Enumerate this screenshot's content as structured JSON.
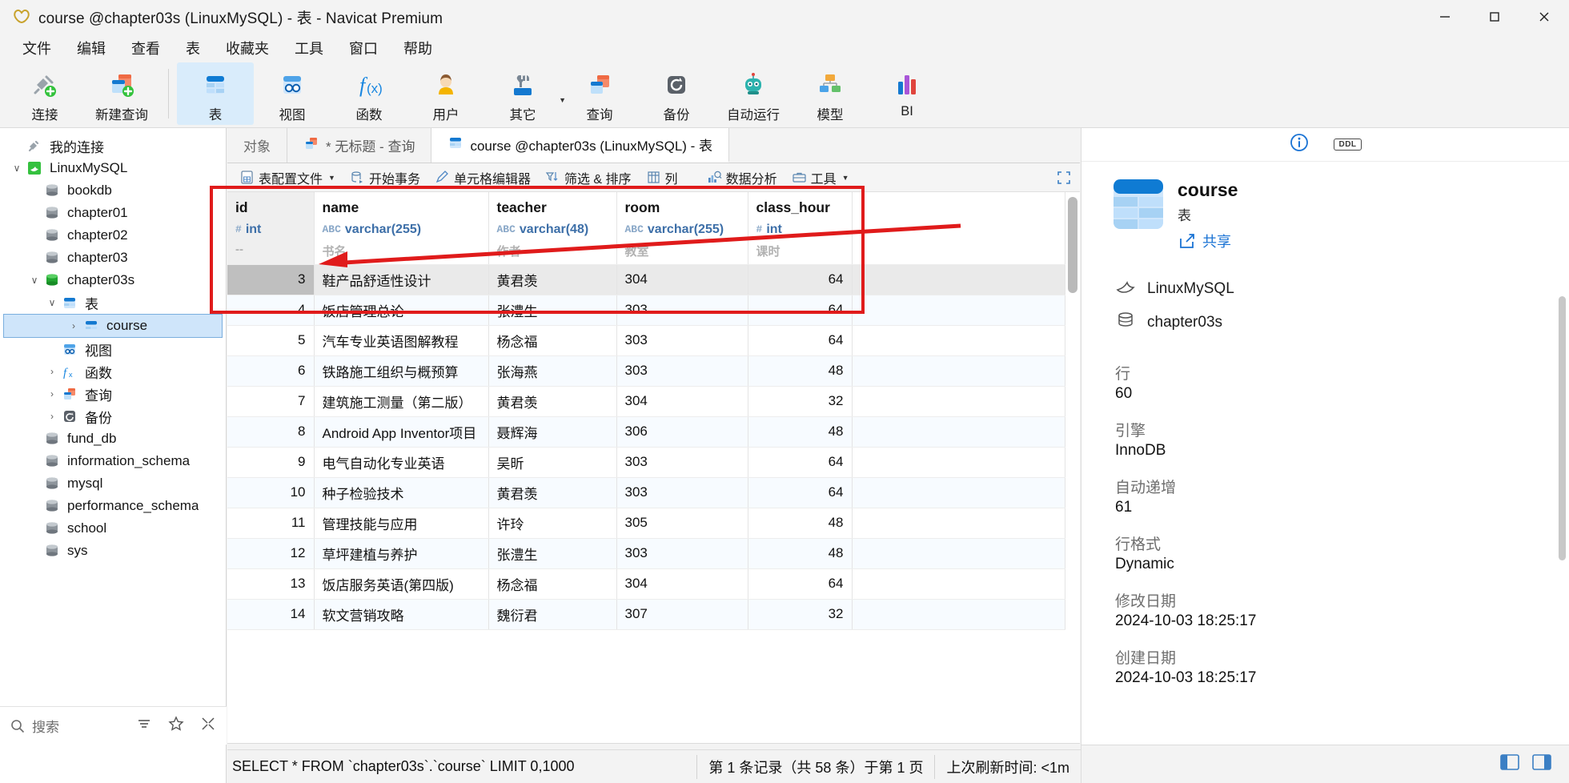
{
  "window": {
    "title": "course @chapter03s (LinuxMySQL) - 表 - Navicat Premium",
    "app_icon": "navicat-logo-icon",
    "minimize_label": "–",
    "maximize_label": "☐",
    "close_label": "✕"
  },
  "menubar": {
    "items": [
      {
        "label": "文件",
        "name": "menu-file"
      },
      {
        "label": "编辑",
        "name": "menu-edit"
      },
      {
        "label": "查看",
        "name": "menu-view"
      },
      {
        "label": "表",
        "name": "menu-table"
      },
      {
        "label": "收藏夹",
        "name": "menu-favorites"
      },
      {
        "label": "工具",
        "name": "menu-tools"
      },
      {
        "label": "窗口",
        "name": "menu-window"
      },
      {
        "label": "帮助",
        "name": "menu-help"
      }
    ]
  },
  "toolbar": {
    "buttons": [
      {
        "label": "连接",
        "icon": "connection-plug-icon",
        "active": false
      },
      {
        "label": "新建查询",
        "icon": "new-query-icon",
        "active": false
      },
      {
        "label": "表",
        "icon": "table-icon",
        "active": true
      },
      {
        "label": "视图",
        "icon": "view-icon",
        "active": false
      },
      {
        "label": "函数",
        "icon": "function-fx-icon",
        "active": false
      },
      {
        "label": "用户",
        "icon": "user-icon",
        "active": false
      },
      {
        "label": "其它",
        "icon": "other-tools-icon",
        "active": false,
        "has_caret": true
      },
      {
        "label": "查询",
        "icon": "query-icon",
        "active": false
      },
      {
        "label": "备份",
        "icon": "backup-icon",
        "active": false
      },
      {
        "label": "自动运行",
        "icon": "automation-robot-icon",
        "active": false
      },
      {
        "label": "模型",
        "icon": "model-icon",
        "active": false
      },
      {
        "label": "BI",
        "icon": "bi-chart-icon",
        "active": false
      }
    ]
  },
  "sidebar": {
    "tree": [
      {
        "label": "我的连接",
        "icon": "plug-icon",
        "indent": 0,
        "arrow": "",
        "selected": false
      },
      {
        "label": "LinuxMySQL",
        "icon": "mysql-dolphin-icon",
        "indent": 1,
        "arrow": "∨",
        "selected": false
      },
      {
        "label": "bookdb",
        "icon": "database-icon",
        "indent": 2,
        "arrow": "",
        "selected": false
      },
      {
        "label": "chapter01",
        "icon": "database-icon",
        "indent": 2,
        "arrow": "",
        "selected": false
      },
      {
        "label": "chapter02",
        "icon": "database-icon",
        "indent": 2,
        "arrow": "",
        "selected": false
      },
      {
        "label": "chapter03",
        "icon": "database-icon",
        "indent": 2,
        "arrow": "",
        "selected": false
      },
      {
        "label": "chapter03s",
        "icon": "database-open-icon",
        "indent": 2,
        "arrow": "∨",
        "selected": false
      },
      {
        "label": "表",
        "icon": "table-folder-icon",
        "indent": 3,
        "arrow": "∨",
        "selected": false
      },
      {
        "label": "course",
        "icon": "table-icon",
        "indent": 4,
        "arrow": "›",
        "selected": true
      },
      {
        "label": "视图",
        "icon": "view-folder-icon",
        "indent": 3,
        "arrow": "",
        "selected": false
      },
      {
        "label": "函数",
        "icon": "function-folder-icon",
        "indent": 3,
        "arrow": "›",
        "selected": false
      },
      {
        "label": "查询",
        "icon": "query-folder-icon",
        "indent": 3,
        "arrow": "›",
        "selected": false
      },
      {
        "label": "备份",
        "icon": "backup-folder-icon",
        "indent": 3,
        "arrow": "›",
        "selected": false
      },
      {
        "label": "fund_db",
        "icon": "database-icon",
        "indent": 2,
        "arrow": "",
        "selected": false
      },
      {
        "label": "information_schema",
        "icon": "database-icon",
        "indent": 2,
        "arrow": "",
        "selected": false
      },
      {
        "label": "mysql",
        "icon": "database-icon",
        "indent": 2,
        "arrow": "",
        "selected": false
      },
      {
        "label": "performance_schema",
        "icon": "database-icon",
        "indent": 2,
        "arrow": "",
        "selected": false
      },
      {
        "label": "school",
        "icon": "database-icon",
        "indent": 2,
        "arrow": "",
        "selected": false
      },
      {
        "label": "sys",
        "icon": "database-icon",
        "indent": 2,
        "arrow": "",
        "selected": false
      }
    ],
    "search_placeholder": "搜索",
    "search_value": "",
    "bottom_icons": [
      "filter-icon",
      "star-icon",
      "collapse-icon"
    ]
  },
  "tabs": [
    {
      "label": "对象",
      "icon": "",
      "active": false,
      "name": "tab-objects"
    },
    {
      "label": "* 无标题 - 查询",
      "icon": "query-icon",
      "active": false,
      "name": "tab-untitled-query"
    },
    {
      "label": "course @chapter03s (LinuxMySQL) - 表",
      "icon": "table-icon",
      "active": true,
      "name": "tab-course-table"
    }
  ],
  "grid_toolbar": [
    {
      "label": "表配置文件",
      "icon": "table-profile-icon",
      "caret": true
    },
    {
      "label": "开始事务",
      "icon": "begin-transaction-icon",
      "caret": false
    },
    {
      "label": "单元格编辑器",
      "icon": "cell-editor-icon",
      "caret": false
    },
    {
      "label": "筛选 & 排序",
      "icon": "filter-sort-icon",
      "caret": false
    },
    {
      "label": "列",
      "icon": "columns-icon",
      "caret": false
    },
    {
      "label": "数据分析",
      "icon": "data-analysis-icon",
      "caret": false
    },
    {
      "label": "工具",
      "icon": "toolbox-icon",
      "caret": true
    }
  ],
  "table": {
    "columns": [
      {
        "name": "id",
        "type": "int",
        "type_icon": "#",
        "comment": "--"
      },
      {
        "name": "name",
        "type": "varchar(255)",
        "type_icon": "ABC",
        "comment": "书名"
      },
      {
        "name": "teacher",
        "type": "varchar(48)",
        "type_icon": "ABC",
        "comment": "作者"
      },
      {
        "name": "room",
        "type": "varchar(255)",
        "type_icon": "ABC",
        "comment": "教室"
      },
      {
        "name": "class_hour",
        "type": "int",
        "type_icon": "#",
        "comment": "课时"
      },
      {
        "name": "",
        "type": "",
        "type_icon": "",
        "comment": ""
      }
    ],
    "rows": [
      {
        "id": "3",
        "name": "鞋产品舒适性设计",
        "teacher": "黄君羡",
        "room": "304",
        "class_hour": "64",
        "selected": true
      },
      {
        "id": "4",
        "name": "饭店管理总论",
        "teacher": "张澧生",
        "room": "303",
        "class_hour": "64",
        "selected": false
      },
      {
        "id": "5",
        "name": "汽车专业英语图解教程",
        "teacher": "杨念福",
        "room": "303",
        "class_hour": "64",
        "selected": false
      },
      {
        "id": "6",
        "name": "铁路施工组织与概预算",
        "teacher": "张海燕",
        "room": "303",
        "class_hour": "48",
        "selected": false
      },
      {
        "id": "7",
        "name": "建筑施工测量（第二版）",
        "teacher": "黄君羡",
        "room": "304",
        "class_hour": "32",
        "selected": false
      },
      {
        "id": "8",
        "name": "Android App Inventor项目",
        "teacher": "聂辉海",
        "room": "306",
        "class_hour": "48",
        "selected": false
      },
      {
        "id": "9",
        "name": "电气自动化专业英语",
        "teacher": "吴昕",
        "room": "303",
        "class_hour": "64",
        "selected": false
      },
      {
        "id": "10",
        "name": "种子检验技术",
        "teacher": "黄君羡",
        "room": "303",
        "class_hour": "64",
        "selected": false
      },
      {
        "id": "11",
        "name": "管理技能与应用",
        "teacher": "许玲",
        "room": "305",
        "class_hour": "48",
        "selected": false
      },
      {
        "id": "12",
        "name": "草坪建植与养护",
        "teacher": "张澧生",
        "room": "303",
        "class_hour": "48",
        "selected": false
      },
      {
        "id": "13",
        "name": "饭店服务英语(第四版)",
        "teacher": "杨念福",
        "room": "304",
        "class_hour": "64",
        "selected": false
      },
      {
        "id": "14",
        "name": "软文营销攻略",
        "teacher": "魏衍君",
        "room": "307",
        "class_hour": "32",
        "selected": false
      }
    ]
  },
  "grid_nav": {
    "add_label": "+",
    "remove_label": "–",
    "apply_label": "✓",
    "cancel_label": "✕",
    "refresh_label": "⟳",
    "stop_label": "■",
    "first_label": "|←",
    "prev_label": "←",
    "page_value": "1",
    "next_label": "→",
    "last_label": "→|",
    "settings_label": "⚙",
    "grid_view_label": "grid-view-icon",
    "form_view_label": "form-view-icon"
  },
  "info_panel": {
    "tab_info_icon": "info-circle-icon",
    "tab_ddl_label": "DDL",
    "object_name": "course",
    "object_type": "表",
    "share_label": "共享",
    "share_icon": "share-icon",
    "connection": "LinuxMySQL",
    "database": "chapter03s",
    "properties": [
      {
        "key": "行",
        "value": "60"
      },
      {
        "key": "引擎",
        "value": "InnoDB"
      },
      {
        "key": "自动递增",
        "value": "61"
      },
      {
        "key": "行格式",
        "value": "Dynamic"
      },
      {
        "key": "修改日期",
        "value": "2024-10-03 18:25:17"
      },
      {
        "key": "创建日期",
        "value": "2024-10-03 18:25:17"
      }
    ]
  },
  "statusbar": {
    "sql": "SELECT * FROM `chapter03s`.`course` LIMIT 0,1000",
    "record_info": "第 1 条记录（共 58 条）于第 1 页",
    "refresh_info": "上次刷新时间: <1m"
  },
  "colors": {
    "accent": "#0e7cd4",
    "annotation_red": "#e01b1b",
    "selection_blue": "#cfe5fa",
    "toolbar_bg": "#f3f3f3"
  }
}
